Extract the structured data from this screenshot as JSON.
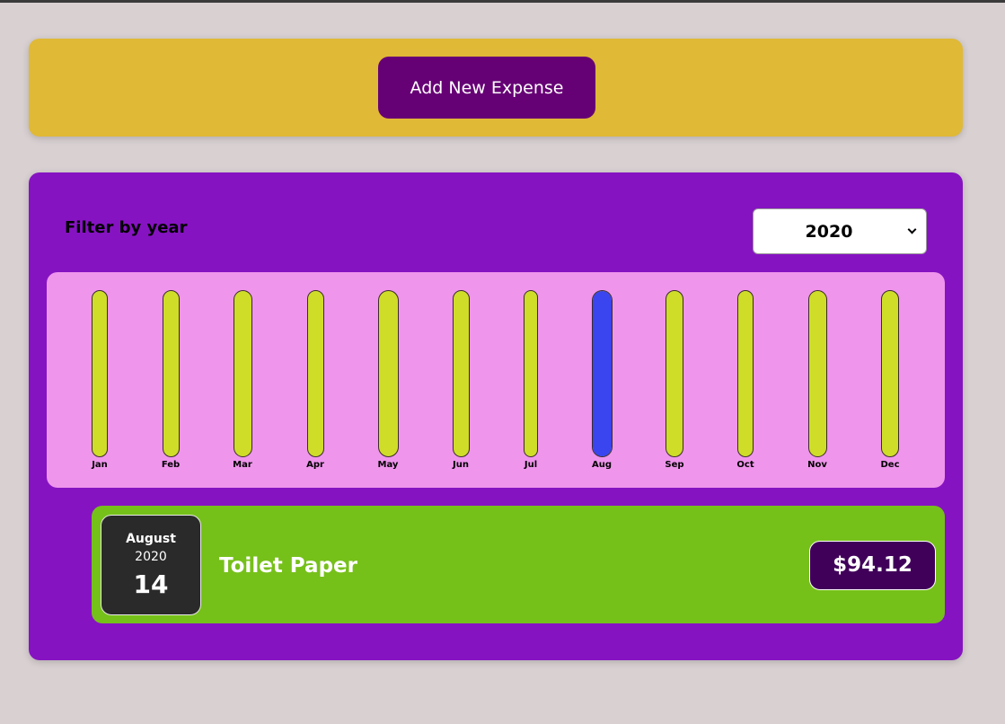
{
  "new_expense": {
    "add_button_label": "Add New Expense",
    "background_color": "#e0b936",
    "button_color": "#660075"
  },
  "expenses_panel": {
    "filter_label": "Filter by year",
    "selected_year": "2020",
    "background_color": "#8613c2"
  },
  "chart": {
    "background_color": "#ef95ec",
    "bar_color": "#cfdd29",
    "fill_color": "#3a44ef",
    "months": [
      {
        "label": "Jan",
        "fill": 0
      },
      {
        "label": "Feb",
        "fill": 0
      },
      {
        "label": "Mar",
        "fill": 0
      },
      {
        "label": "Apr",
        "fill": 0
      },
      {
        "label": "May",
        "fill": 0
      },
      {
        "label": "Jun",
        "fill": 0
      },
      {
        "label": "Jul",
        "fill": 0
      },
      {
        "label": "Aug",
        "fill": 1
      },
      {
        "label": "Sep",
        "fill": 0
      },
      {
        "label": "Oct",
        "fill": 0
      },
      {
        "label": "Nov",
        "fill": 0
      },
      {
        "label": "Dec",
        "fill": 0
      }
    ]
  },
  "expense_items": [
    {
      "month": "August",
      "year": "2020",
      "day": "14",
      "title": "Toilet Paper",
      "amount": "$94.12",
      "item_color": "#76c01a",
      "amount_color": "#40005a"
    }
  ]
}
